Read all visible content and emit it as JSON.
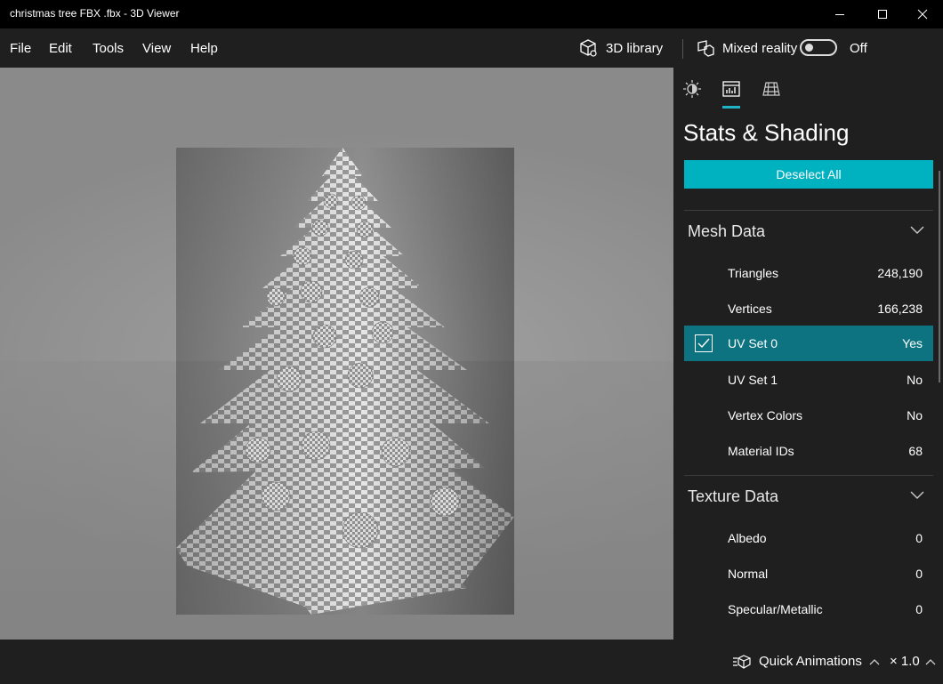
{
  "window": {
    "title": "christmas tree FBX .fbx - 3D Viewer"
  },
  "menu": {
    "items": [
      "File",
      "Edit",
      "Tools",
      "View",
      "Help"
    ]
  },
  "toolbar": {
    "library_label": "3D library",
    "mixed_reality_label": "Mixed reality",
    "mixed_reality_state": "Off"
  },
  "panel": {
    "tab_icons": [
      "lighting-icon",
      "stats-icon",
      "grid-icon"
    ],
    "title": "Stats & Shading",
    "deselect_label": "Deselect All",
    "mesh": {
      "header": "Mesh Data",
      "rows": [
        {
          "label": "Triangles",
          "value": "248,190"
        },
        {
          "label": "Vertices",
          "value": "166,238"
        },
        {
          "label": "UV Set 0",
          "value": "Yes",
          "checked": true
        },
        {
          "label": "UV Set 1",
          "value": "No"
        },
        {
          "label": "Vertex Colors",
          "value": "No"
        },
        {
          "label": "Material IDs",
          "value": "68"
        }
      ]
    },
    "texture": {
      "header": "Texture Data",
      "rows": [
        {
          "label": "Albedo",
          "value": "0"
        },
        {
          "label": "Normal",
          "value": "0"
        },
        {
          "label": "Specular/Metallic",
          "value": "0"
        }
      ]
    }
  },
  "bottom": {
    "quick_animations_label": "Quick Animations",
    "speed": "× 1.0"
  },
  "colors": {
    "accent": "#00b1bf",
    "selected_row": "#0e7380",
    "background": "#1f1f1f"
  }
}
